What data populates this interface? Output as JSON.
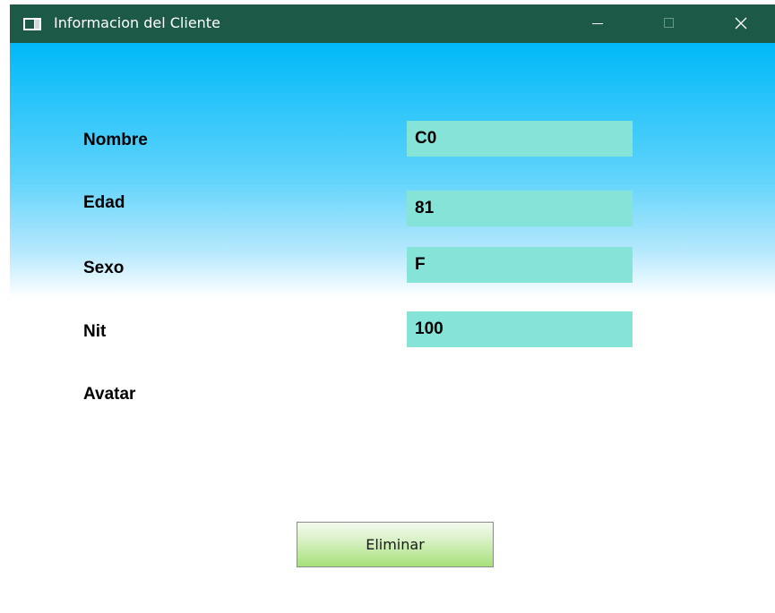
{
  "window": {
    "title": "Informacion del Cliente",
    "icon": "window-app-icon"
  },
  "form": {
    "fields": [
      {
        "label": "Nombre",
        "value": "C0"
      },
      {
        "label": "Edad",
        "value": "81"
      },
      {
        "label": "Sexo",
        "value": "F"
      },
      {
        "label": "Nit",
        "value": "100"
      }
    ],
    "avatar_label": "Avatar"
  },
  "actions": {
    "delete_label": "Eliminar"
  },
  "colors": {
    "titlebar": "#1c5946",
    "gradient_top": "#00b9f8",
    "field_background": "#86e3d8",
    "button_green": "#a7e07a"
  }
}
